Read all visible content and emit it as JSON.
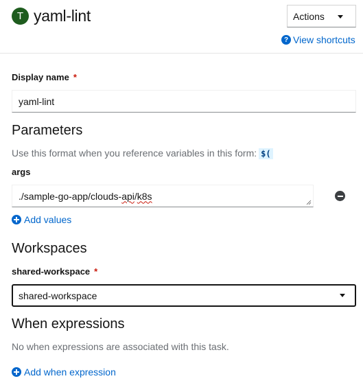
{
  "header": {
    "badge_letter": "T",
    "title": "yaml-lint",
    "actions_label": "Actions",
    "view_shortcuts_label": "View shortcuts"
  },
  "display_name": {
    "label": "Display name",
    "required_mark": "*",
    "value": "yaml-lint"
  },
  "parameters": {
    "heading": "Parameters",
    "helper_text": "Use this format when you reference variables in this form:",
    "format_chip": "$(",
    "args": {
      "label": "args",
      "value_prefix": "./sample-go-app/clouds-",
      "value_spell1": "api",
      "value_sep": "/",
      "value_spell2": "k8s"
    },
    "add_values_label": "Add values"
  },
  "workspaces": {
    "heading": "Workspaces",
    "field_label": "shared-workspace",
    "required_mark": "*",
    "selected_value": "shared-workspace"
  },
  "when_expressions": {
    "heading": "When expressions",
    "empty_text": "No when expressions are associated with this task.",
    "add_label": "Add when expression"
  },
  "colors": {
    "link": "#0066cc",
    "required": "#c9190b",
    "badge": "#1e5c1e",
    "chip_bg": "#def3ff"
  }
}
